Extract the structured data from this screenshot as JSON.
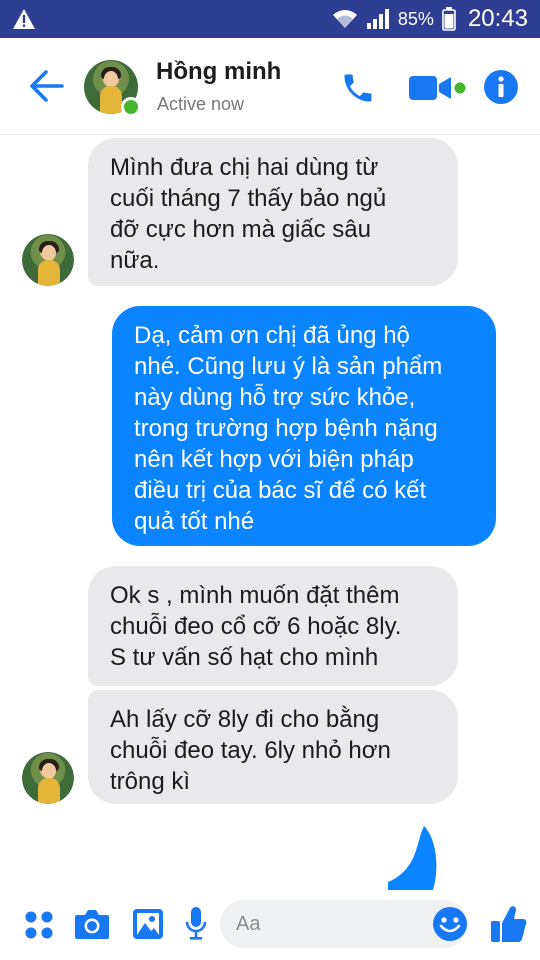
{
  "status_bar": {
    "battery": "85%",
    "time": "20:43"
  },
  "header": {
    "contact_name": "Hồng minh",
    "status": "Active now"
  },
  "messages": [
    {
      "from": "contact",
      "text": "Mình đưa chị hai dùng từ\ncuối tháng 7 thấy bảo ngủ\nđỡ cực hơn mà giấc sâu\nnữa."
    },
    {
      "from": "me",
      "text": "Dạ, cảm ơn chị đã ủng hộ\nnhé. Cũng lưu ý là sản phẩm\nnày dùng hỗ trợ sức khỏe,\ntrong trường hợp bệnh nặng\nnên kết hợp với biện pháp\nđiều trị của bác sĩ để có kết\nquả tốt nhé"
    },
    {
      "from": "contact",
      "text": "Ok s , mình muốn đặt thêm\nchuỗi đeo cổ cỡ 6 hoặc 8ly.\nS tư vấn số hạt cho mình"
    },
    {
      "from": "contact",
      "text": "Ah lấy cỡ 8ly đi cho bằng\nchuỗi đeo tay. 6ly nhỏ hơn\ntrông kì"
    }
  ],
  "composer": {
    "placeholder": "Aa"
  },
  "colors": {
    "status_bar": "#2e3e93",
    "accent": "#0a84ff",
    "incoming_bubble": "#e9e9ec",
    "online": "#42b72a"
  }
}
